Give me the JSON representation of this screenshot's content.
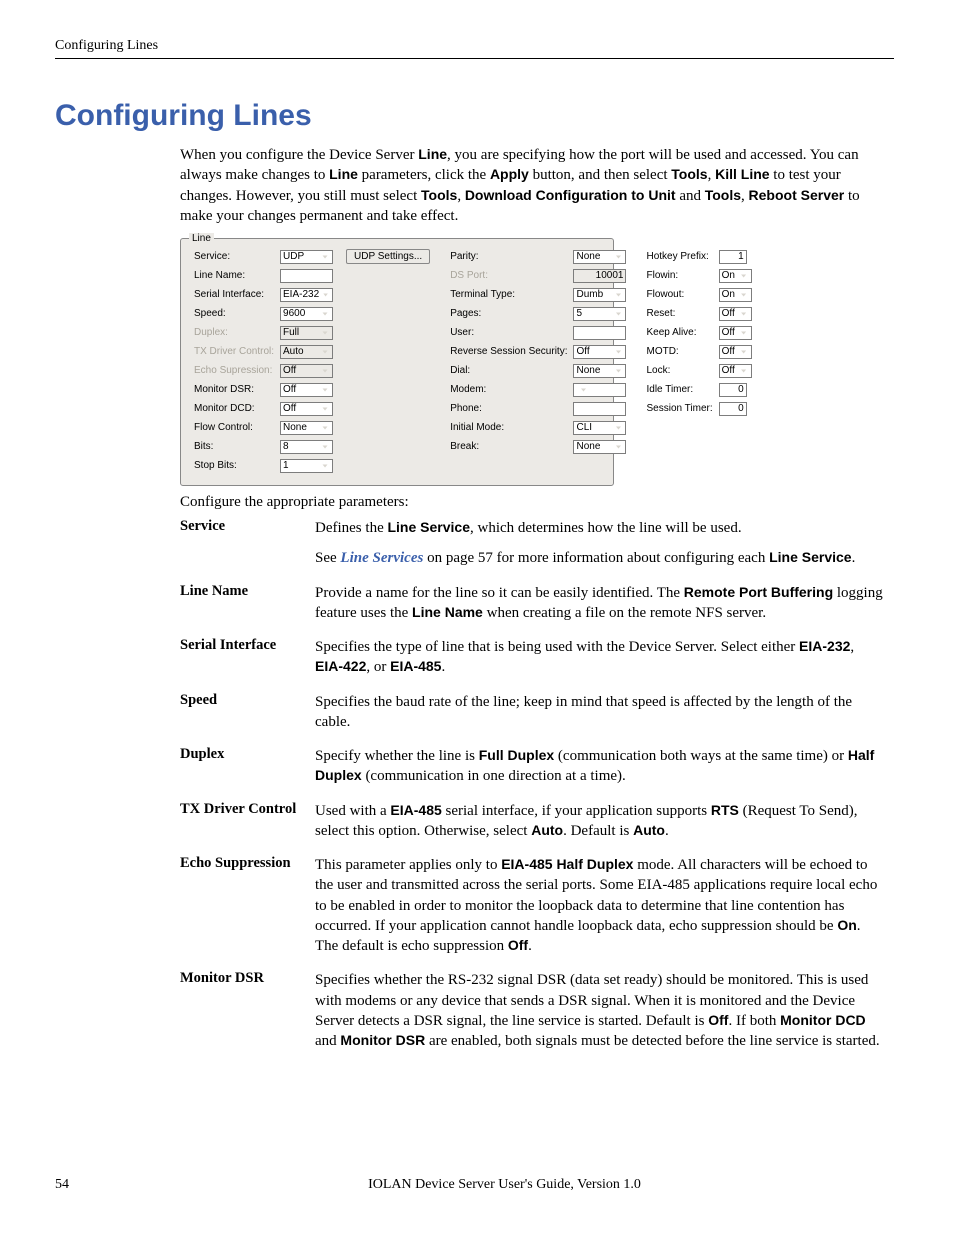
{
  "running_header": "Configuring Lines",
  "h1": "Configuring Lines",
  "intro": {
    "t1": "When you configure the Device Server ",
    "b1": "Line",
    "t2": ", you are specifying how the port will be used and accessed. You can always make changes to ",
    "b2": "Line",
    "t3": " parameters, click the ",
    "b3": "Apply",
    "t4": " button, and then select ",
    "b4": "Tools",
    "t5": ", ",
    "b5": "Kill Line",
    "t6": " to test your changes. However, you still must select ",
    "b6": "Tools",
    "t7": ", ",
    "b7": "Download Configuration to Unit",
    "t8": " and ",
    "b8": "Tools",
    "t9": ", ",
    "b9": "Reboot Server",
    "t10": " to make your changes permanent and take effect."
  },
  "form": {
    "legend": "Line",
    "c1": [
      {
        "l": "Service:",
        "v": "UDP",
        "btn": "UDP Settings..."
      },
      {
        "l": "Line Name:",
        "v": ""
      },
      {
        "l": "Serial Interface:",
        "v": "EIA-232"
      },
      {
        "l": "Speed:",
        "v": "9600"
      },
      {
        "l": "Duplex:",
        "v": "Full",
        "dim": true
      },
      {
        "l": "TX Driver Control:",
        "v": "Auto",
        "dim": true
      },
      {
        "l": "Echo Supression:",
        "v": "Off",
        "dim": true
      },
      {
        "l": "Monitor DSR:",
        "v": "Off"
      },
      {
        "l": "Monitor DCD:",
        "v": "Off"
      },
      {
        "l": "Flow Control:",
        "v": "None"
      },
      {
        "l": "Bits:",
        "v": "8"
      },
      {
        "l": "Stop Bits:",
        "v": "1"
      }
    ],
    "c2": [
      {
        "l": "Parity:",
        "v": "None"
      },
      {
        "l": "DS Port:",
        "v": "10001",
        "num": true,
        "dim": true
      },
      {
        "l": "Terminal Type:",
        "v": "Dumb"
      },
      {
        "l": "Pages:",
        "v": "5"
      },
      {
        "l": "User:",
        "v": ""
      },
      {
        "l": "Reverse Session Security:",
        "v": "Off"
      },
      {
        "l": "Dial:",
        "v": "None"
      },
      {
        "l": "Modem:",
        "v": ""
      },
      {
        "l": "Phone:",
        "v": ""
      },
      {
        "l": "Initial Mode:",
        "v": "CLI"
      },
      {
        "l": "Break:",
        "v": "None"
      }
    ],
    "c3": [
      {
        "l": "Hotkey Prefix:",
        "v": "1",
        "num": true
      },
      {
        "l": "Flowin:",
        "v": "On"
      },
      {
        "l": "Flowout:",
        "v": "On"
      },
      {
        "l": "Reset:",
        "v": "Off"
      },
      {
        "l": "Keep Alive:",
        "v": "Off"
      },
      {
        "l": "MOTD:",
        "v": "Off"
      },
      {
        "l": "Lock:",
        "v": "Off"
      },
      {
        "l": "Idle Timer:",
        "v": "0",
        "num": true
      },
      {
        "l": "Session Timer:",
        "v": "0",
        "num": true
      }
    ]
  },
  "params_lead": "Configure the appropriate parameters:",
  "rows": {
    "service": {
      "k": "Service",
      "t1": "Defines the ",
      "b1": "Line Service",
      "t2": ", which determines how the line will be used.",
      "see1": "See ",
      "link": "Line Services",
      "see2": " on page 57",
      "see3": " for more information about configuring each ",
      "b2": "Line Service",
      "dot": "."
    },
    "linename": {
      "k": "Line Name",
      "t1": "Provide a name for the line so it can be easily identified. The ",
      "b1": "Remote Port Buffering",
      "t2": " logging feature uses the ",
      "b2": "Line Name",
      "t3": " when creating a file on the remote NFS server."
    },
    "si": {
      "k": "Serial Interface",
      "t1": "Specifies the type of line that is being used with the Device Server. Select either ",
      "b1": "EIA-232",
      "t2": ", ",
      "b2": "EIA-422",
      "t3": ", or ",
      "b3": "EIA-485",
      "t4": "."
    },
    "speed": {
      "k": "Speed",
      "t": "Specifies the baud rate of the line; keep in mind that speed is affected by the length of the cable."
    },
    "duplex": {
      "k": "Duplex",
      "t1": "Specify whether the line is ",
      "b1": "Full Duplex",
      "t2": " (communication both ways at the same time) or ",
      "b2": "Half Duplex",
      "t3": " (communication in one direction at a time)."
    },
    "tx": {
      "k": "TX Driver Control",
      "t1": "Used with a ",
      "b1": "EIA-485",
      "t2": " serial interface, if your application supports ",
      "b2": "RTS",
      "t3": " (Request To Send), select this option. Otherwise, select ",
      "b3": "Auto",
      "t4": ". Default is ",
      "b4": "Auto",
      "t5": "."
    },
    "echo": {
      "k": "Echo Suppression",
      "t1": "This parameter applies only to ",
      "b1": "EIA-485 Half Duplex",
      "t2": " mode. All characters will be echoed to the user and transmitted across the serial ports. Some EIA-485 applications require local echo to be enabled in order to monitor the loopback data to determine that line contention has occurred. If your application cannot handle loopback data, echo suppression should be ",
      "b2": "On",
      "t3": ". The default is echo suppression ",
      "b3": "Off",
      "t4": "."
    },
    "mdsr": {
      "k": "Monitor DSR",
      "t1": "Specifies whether the RS-232 signal DSR (data set ready) should be monitored. This is used with modems or any device that sends a DSR signal. When it is monitored and the Device Server detects a DSR signal, the line service is started. Default is ",
      "b1": "Off",
      "t2": ". If both ",
      "b2": "Monitor DCD",
      "t3": " and ",
      "b3": "Monitor DSR",
      "t4": " are enabled, both signals must be detected before the line service is started."
    }
  },
  "page_number": "54",
  "footer": "IOLAN Device Server User's Guide, Version 1.0"
}
